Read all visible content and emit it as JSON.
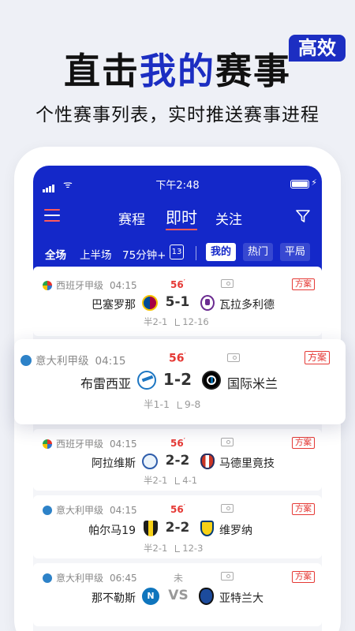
{
  "promo": {
    "headline_prefix": "直击",
    "headline_highlight": "我的",
    "headline_suffix": "赛事",
    "badge": "高效",
    "subline": "个性赛事列表，实时推送赛事进程"
  },
  "status_bar": {
    "time": "下午2:48"
  },
  "nav": {
    "tabs": [
      "赛程",
      "即时",
      "关注"
    ],
    "active_tab": "即时"
  },
  "subtabs": {
    "items": [
      "全场",
      "上半场",
      "75分钟+"
    ],
    "calendar_day": "13",
    "pills": [
      "我的",
      "热门",
      "平局"
    ],
    "active_pill": "我的"
  },
  "matches": [
    {
      "league": "西班牙甲级",
      "kickoff": "04:15",
      "minute": "56",
      "home": "巴塞罗那",
      "score": "5-1",
      "away": "瓦拉多利德",
      "halftime": "半2-1",
      "corners": "12-16",
      "plan": "方案"
    },
    {
      "league": "意大利甲级",
      "kickoff": "04:15",
      "minute": "56",
      "home": "布雷西亚",
      "score": "1-2",
      "away": "国际米兰",
      "halftime": "半1-1",
      "corners": "9-8",
      "plan": "方案"
    },
    {
      "league": "西班牙甲级",
      "kickoff": "04:15",
      "minute": "56",
      "home": "阿拉维斯",
      "score": "2-2",
      "away": "马德里竟技",
      "halftime": "半2-1",
      "corners": "4-1",
      "plan": "方案"
    },
    {
      "league": "意大利甲级",
      "kickoff": "04:15",
      "minute": "56",
      "home": "帕尔马19",
      "score": "2-2",
      "away": "维罗纳",
      "halftime": "半2-1",
      "corners": "12-3",
      "plan": "方案"
    },
    {
      "league": "意大利甲级",
      "kickoff": "06:45",
      "minute": "未",
      "home": "那不勒斯",
      "score": "VS",
      "away": "亚特兰大",
      "plan": "方案"
    }
  ],
  "colors": {
    "brand": "#1428c9",
    "accent_red": "#e53935"
  }
}
